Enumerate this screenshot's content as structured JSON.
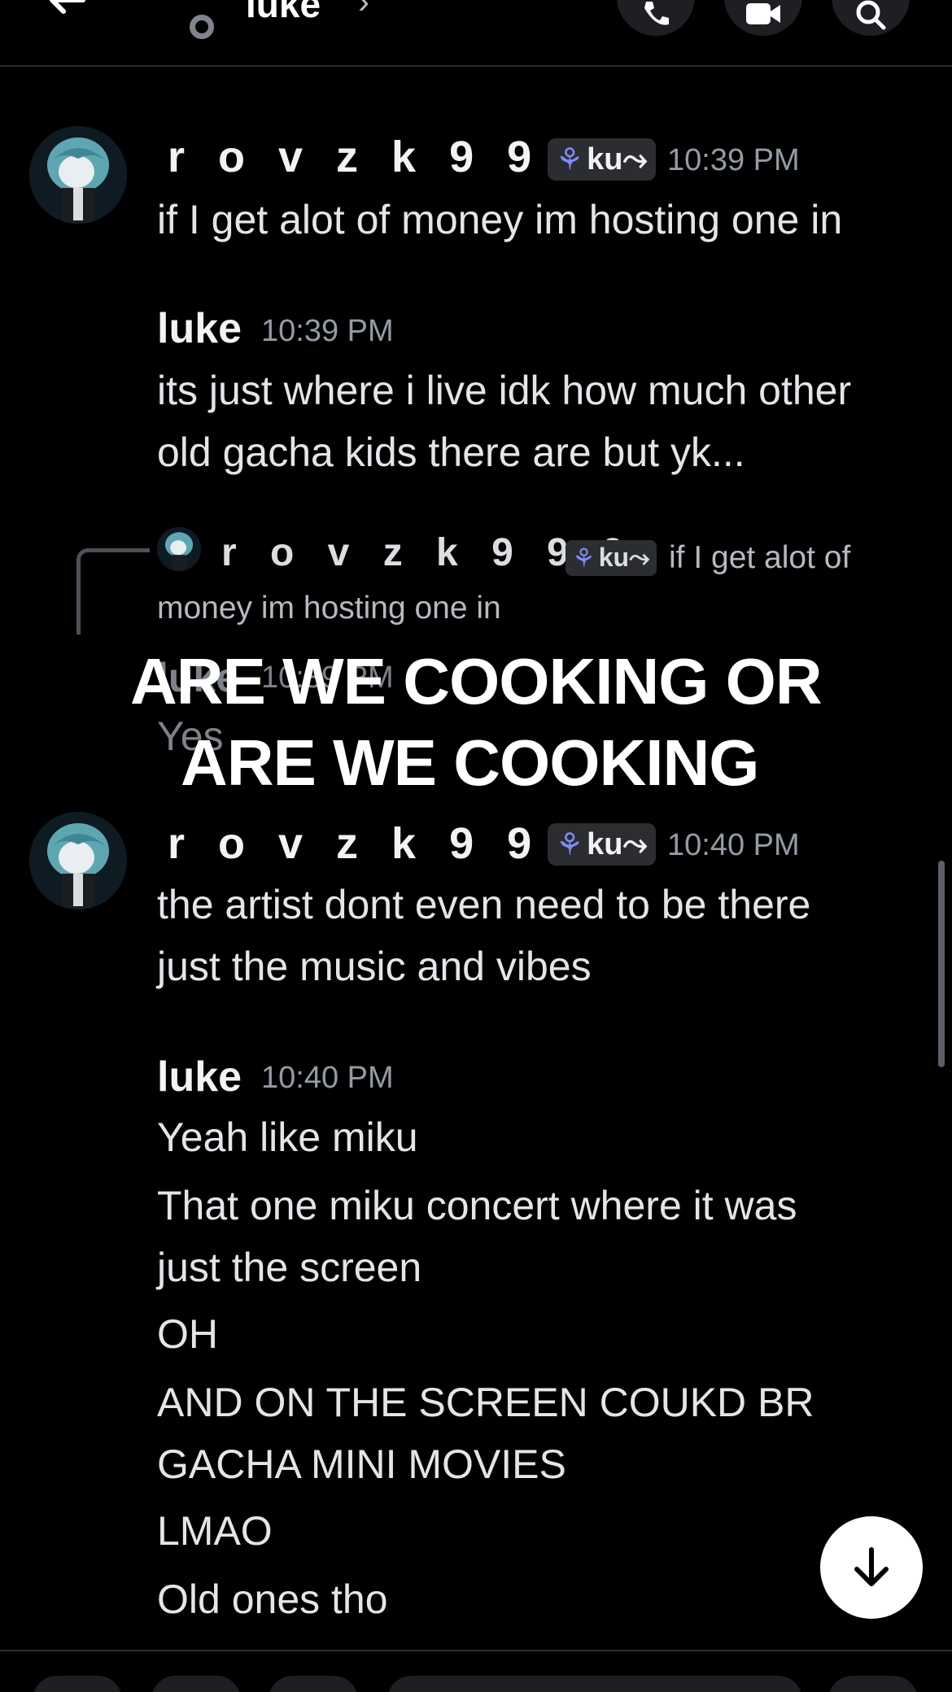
{
  "header": {
    "title": "luke",
    "chevron": "›",
    "icons": [
      "back-arrow-icon",
      "status-icon",
      "phone-icon",
      "video-icon",
      "search-icon"
    ]
  },
  "badge": {
    "emoji": "⚘",
    "text": "ku⤳"
  },
  "messages": [
    {
      "author": "r o v z k 9 9 9",
      "time": "10:39 PM",
      "lines": [
        "if I get alot of money im hosting one in"
      ]
    },
    {
      "author": "luke",
      "time": "10:39 PM",
      "lines": [
        "its just where i live idk how much other",
        "old gacha kids there are but yk..."
      ]
    },
    {
      "reply": {
        "author": "r o v z k 9 9 9",
        "text_line1": "if I get alot of",
        "text_line2": "money im hosting one in"
      },
      "author": "luke",
      "time": "10:39 PM",
      "lines": [
        "Yes"
      ]
    },
    {
      "author": "r o v z k 9 9 9",
      "time": "10:40 PM",
      "lines": [
        "the artist dont even need to be there",
        "just the music and vibes"
      ]
    },
    {
      "author": "luke",
      "time": "10:40 PM",
      "lines": [
        "Yeah like miku",
        "That one miku concert where it was",
        "just the screen",
        "OH",
        "AND ON THE SCREEN COUKD BR",
        "GACHA MINI MOVIES",
        "LMAO",
        "Old ones tho"
      ]
    }
  ],
  "overlay_caption": {
    "line1": "ARE WE COOKING OR",
    "line2": "ARE WE COOKING"
  },
  "colors": {
    "background": "#000000",
    "text": "#f2f3f5",
    "timestamp": "#949ba4",
    "badge_bg": "#2b2d31",
    "badge_icon": "#7f8cf7"
  }
}
